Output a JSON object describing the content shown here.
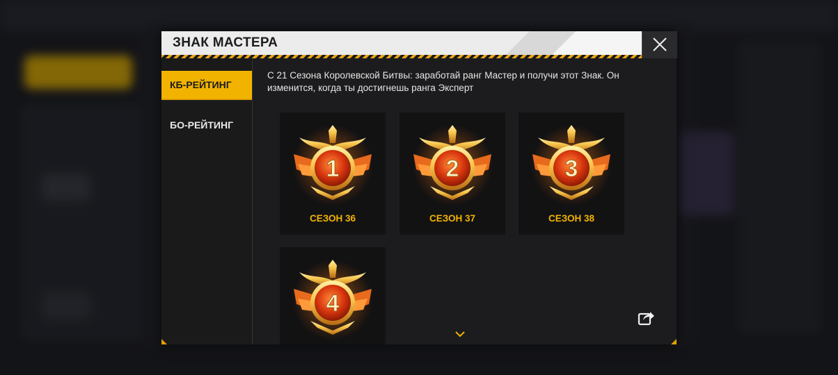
{
  "dialog": {
    "title": "ЗНАК МАСТЕРА",
    "description": "С 21 Сезона Королевской Битвы: заработай ранг Мастер и получи этот Знак. Он изменится, когда ты достигнешь ранга Эксперт"
  },
  "tabs": [
    {
      "label": "КБ-РЕЙТИНГ",
      "active": true
    },
    {
      "label": "БО-РЕЙТИНГ",
      "active": false
    }
  ],
  "badges": [
    {
      "number": "1",
      "label": "СЕЗОН 36"
    },
    {
      "number": "2",
      "label": "СЕЗОН 37"
    },
    {
      "number": "3",
      "label": "СЕЗОН 38"
    },
    {
      "number": "4",
      "label": ""
    }
  ],
  "icons": {
    "close": "close-icon",
    "share": "share-icon",
    "scroll_down": "chevron-down-icon"
  },
  "colors": {
    "accent": "#f2b300",
    "header_bg": "#ececec",
    "panel_bg": "#1c1c1e"
  }
}
